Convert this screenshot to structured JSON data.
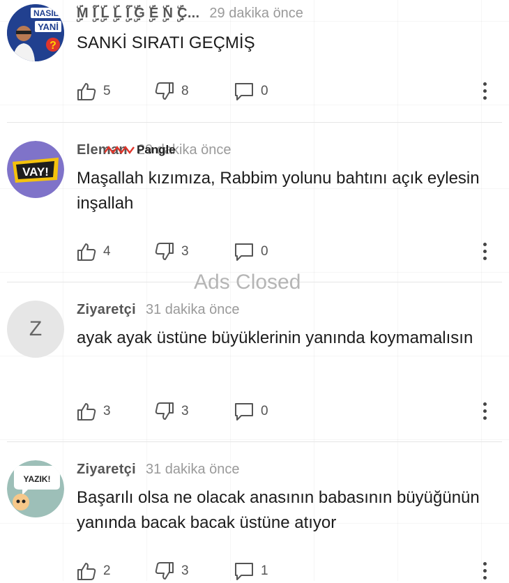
{
  "ads_overlay": {
    "label": "Ads Closed",
    "sponsor": "Pangle"
  },
  "comments": [
    {
      "author": "ۣۜM ۣۜİ ۣۜL ۣۜL ۣۜİ ۣۜG ۣۜE ۣۜN ۣۜÇ...",
      "time": "29 dakika önce",
      "text": "SANKİ SIRATI GEÇMİŞ",
      "avatar": {
        "line1": "NASIL",
        "line2": "YANİ",
        "mark": "?"
      },
      "likes": "5",
      "dislikes": "8",
      "replies": "0"
    },
    {
      "author": "Eleman",
      "time": "29 dakika önce",
      "text": "Maşallah kızımıza, Rabbim yolunu bahtını açık eylesin inşallah",
      "avatar": {
        "label": "VAY!"
      },
      "likes": "4",
      "dislikes": "3",
      "replies": "0"
    },
    {
      "author": "Ziyaretçi",
      "time": "31 dakika önce",
      "text": "ayak ayak üstüne büyüklerinin yanında koymamalısın",
      "avatar": {
        "initial": "Z"
      },
      "likes": "3",
      "dislikes": "3",
      "replies": "0"
    },
    {
      "author": "Ziyaretçi",
      "time": "31 dakika önce",
      "text": "Başarılı olsa ne olacak anasının babasının büyüğünün yanında bacak bacak üstüne atıyor",
      "avatar": {
        "label": "YAZIK!"
      },
      "likes": "2",
      "dislikes": "3",
      "replies": "1"
    }
  ],
  "colors": {
    "divider": "#e6e6e6",
    "icon": "#555555",
    "time": "#9a9a9a",
    "ads": "#b5b5b5"
  },
  "icons": [
    "thumbs-up-icon",
    "thumbs-down-icon",
    "comment-bubble-icon",
    "more-vert-icon"
  ]
}
